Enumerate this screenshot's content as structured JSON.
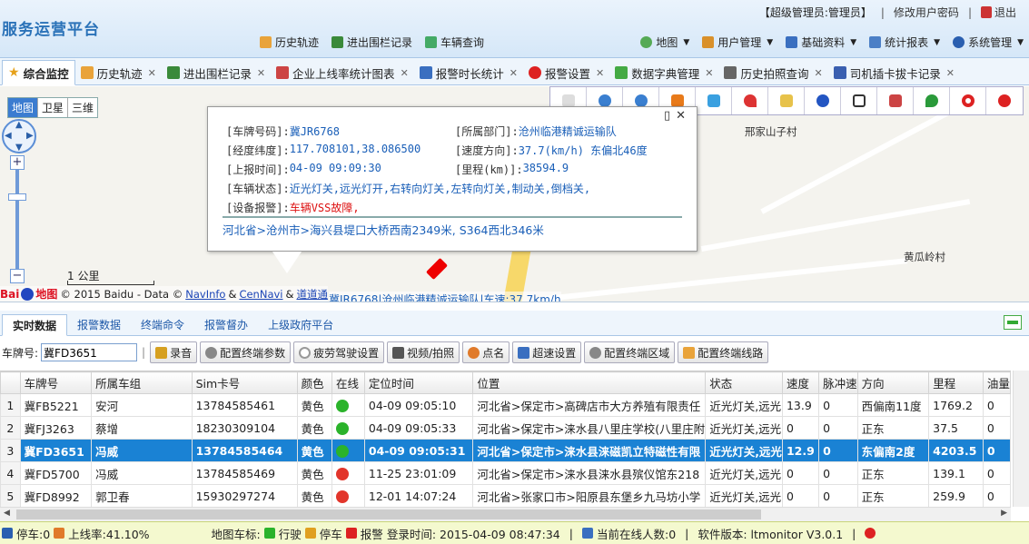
{
  "header": {
    "app_title": "服务运营平台",
    "user_label": "【超级管理员:管理员】",
    "change_password": "修改用户密码",
    "logout": "退出",
    "quick_menu": [
      "历史轨迹",
      "进出围栏记录",
      "车辆查询"
    ],
    "main_menu": [
      "地图",
      "用户管理",
      "基础资料",
      "统计报表",
      "系统管理"
    ]
  },
  "tabs": [
    {
      "label": "综合监控",
      "closable": false
    },
    {
      "label": "历史轨迹",
      "closable": true
    },
    {
      "label": "进出围栏记录",
      "closable": true
    },
    {
      "label": "企业上线率统计图表",
      "closable": true
    },
    {
      "label": "报警时长统计",
      "closable": true
    },
    {
      "label": "报警设置",
      "closable": true
    },
    {
      "label": "数据字典管理",
      "closable": true
    },
    {
      "label": "历史拍照查询",
      "closable": true
    },
    {
      "label": "司机插卡拔卡记录",
      "closable": true
    }
  ],
  "map": {
    "types": [
      "地图",
      "卫星",
      "三维"
    ],
    "scale_label": "1 公里",
    "copyright": {
      "text": "© 2015 Baidu - Data ©",
      "navinfo": "NavInfo",
      "amp": "&",
      "cennavi": "CenNavi",
      "amp2": "&",
      "daodaotong": "道道通"
    },
    "baidu_logo": {
      "left": "Bai",
      "right": "地图"
    },
    "places": [
      "邢家山子村",
      "黄瓜岭村"
    ],
    "car_label": "冀JR6768|沧州临港精诚运输队|车速:37.7km/h",
    "popup": {
      "plate_label": "[车牌号码]:",
      "plate": "冀JR6768",
      "dept_label": "[所属部门]:",
      "dept": "沧州临港精诚运输队",
      "lnglat_label": "[经度纬度]:",
      "lnglat": "117.708101,38.086500",
      "speed_label": "[速度方向]:",
      "speed": "37.7(km/h) 东偏北46度",
      "time_label": "[上报时间]:",
      "time": "04-09 09:09:30",
      "mileage_label": "[里程(km)]:",
      "mileage": "38594.9",
      "status_label": "[车辆状态]:",
      "status": "近光灯关,远光灯开,右转向灯关,左转向灯关,制动关,倒档关,",
      "alarm_label": "[设备报警]:",
      "alarm": "车辆VSS故障,",
      "address": "河北省>沧州市>海兴县堤口大桥西南2349米, S364西北346米",
      "close": "✕"
    }
  },
  "panel_tabs": [
    "实时数据",
    "报警数据",
    "终端命令",
    "报警督办",
    "上级政府平台"
  ],
  "command_bar": {
    "plate_label": "车牌号:",
    "plate_value": "冀FD3651",
    "buttons": [
      "录音",
      "配置终端参数",
      "疲劳驾驶设置",
      "视频/拍照",
      "点名",
      "超速设置",
      "配置终端区域",
      "配置终端线路"
    ]
  },
  "table": {
    "columns": [
      "",
      "车牌号",
      "所属车组",
      "Sim卡号",
      "颜色",
      "在线",
      "定位时间",
      "位置",
      "状态",
      "速度",
      "脉冲速",
      "方向",
      "里程",
      "油量"
    ],
    "rows": [
      {
        "idx": "1",
        "plate": "冀FB5221",
        "group": "安河",
        "sim": "13784585461",
        "color": "黄色",
        "online": true,
        "time": "04-09 09:05:10",
        "location": "河北省>保定市>高碑店市大方养殖有限责任",
        "status": "近光灯关,远光",
        "speed": "13.9",
        "pulse": "0",
        "dir": "西偏南11度",
        "mileage": "1769.2",
        "oil": "0"
      },
      {
        "idx": "2",
        "plate": "冀FJ3263",
        "group": "蔡增",
        "sim": "18230309104",
        "color": "黄色",
        "online": true,
        "time": "04-09 09:05:33",
        "location": "河北省>保定市>涞水县八里庄学校(八里庄附",
        "status": "近光灯关,远光",
        "speed": "0",
        "pulse": "0",
        "dir": "正东",
        "mileage": "37.5",
        "oil": "0"
      },
      {
        "idx": "3",
        "plate": "冀FD3651",
        "group": "冯威",
        "sim": "13784585464",
        "color": "黄色",
        "online": true,
        "time": "04-09 09:05:31",
        "location": "河北省>保定市>涞水县涞磁凯立特磁性有限",
        "status": "近光灯关,远光",
        "speed": "12.9",
        "pulse": "0",
        "dir": "东偏南2度",
        "mileage": "4203.5",
        "oil": "0"
      },
      {
        "idx": "4",
        "plate": "冀FD5700",
        "group": "冯威",
        "sim": "13784585469",
        "color": "黄色",
        "online": false,
        "time": "11-25 23:01:09",
        "location": "河北省>保定市>涞水县涞水县殡仪馆东218",
        "status": "近光灯关,远光",
        "speed": "0",
        "pulse": "0",
        "dir": "正东",
        "mileage": "139.1",
        "oil": "0"
      },
      {
        "idx": "5",
        "plate": "冀FD8992",
        "group": "郭卫春",
        "sim": "15930297274",
        "color": "黄色",
        "online": false,
        "time": "12-01 14:07:24",
        "location": "河北省>张家口市>阳原县东堡乡九马坊小学",
        "status": "近光灯关,远光",
        "speed": "0",
        "pulse": "0",
        "dir": "正东",
        "mileage": "259.9",
        "oil": "0"
      }
    ],
    "selected_index": 2
  },
  "statusbar": {
    "stopped": "停车:0",
    "online_rate": "上线率:41.10%",
    "legend_title": "地图车标:",
    "legend_driving": "行驶",
    "legend_parking": "停车",
    "legend_alarm": "报警",
    "login_time": "登录时间: 2015-04-09 08:47:34",
    "sep1": "|",
    "online_users": "当前在线人数:0",
    "sep2": "|",
    "version": "软件版本: ltmonitor V3.0.1",
    "sep3": "|"
  },
  "colors": {
    "accent": "#1a82d4",
    "online": "#2bb32b",
    "offline": "#e2352b",
    "link": "#1a5fb8"
  }
}
